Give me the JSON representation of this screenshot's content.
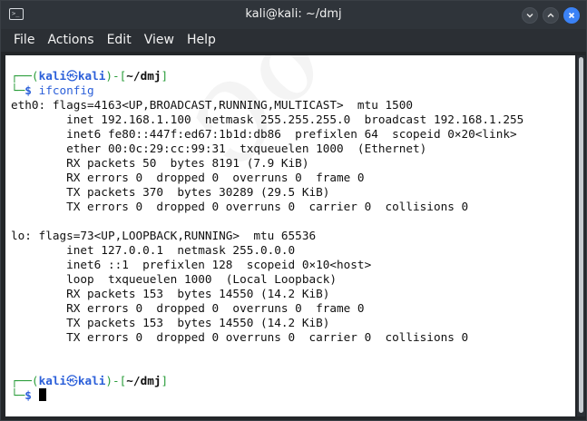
{
  "window": {
    "title": "kali@kali: ~/dmj",
    "app_icon": "terminal-icon",
    "controls": [
      "minimize-icon",
      "maximize-icon",
      "close-icon"
    ],
    "accent": "#3b82f6"
  },
  "menu": {
    "items": [
      "File",
      "Actions",
      "Edit",
      "View",
      "Help"
    ]
  },
  "terminal": {
    "background": "#ffffff",
    "prompt": {
      "open": "┌──(",
      "user": "kali",
      "skull": "㉿",
      "host": "kali",
      "mid": ")-[",
      "path": "~/dmj",
      "close": "]",
      "second": "└─",
      "dollar": "$"
    },
    "command": "ifconfig",
    "output": [
      "eth0: flags=4163<UP,BROADCAST,RUNNING,MULTICAST>  mtu 1500",
      "        inet 192.168.1.100  netmask 255.255.255.0  broadcast 192.168.1.255",
      "        inet6 fe80::447f:ed67:1b1d:db86  prefixlen 64  scopeid 0×20<link>",
      "        ether 00:0c:29:cc:99:31  txqueuelen 1000  (Ethernet)",
      "        RX packets 50  bytes 8191 (7.9 KiB)",
      "        RX errors 0  dropped 0  overruns 0  frame 0",
      "        TX packets 370  bytes 30289 (29.5 KiB)",
      "        TX errors 0  dropped 0 overruns 0  carrier 0  collisions 0",
      "",
      "lo: flags=73<UP,LOOPBACK,RUNNING>  mtu 65536",
      "        inet 127.0.0.1  netmask 255.0.0.0",
      "        inet6 ::1  prefixlen 128  scopeid 0×10<host>",
      "        loop  txqueuelen 1000  (Local Loopback)",
      "        RX packets 153  bytes 14550 (14.2 KiB)",
      "        RX errors 0  dropped 0  overruns 0  frame 0",
      "        TX packets 153  bytes 14550 (14.2 KiB)",
      "        TX errors 0  dropped 0 overruns 0  carrier 0  collisions 0",
      "",
      ""
    ]
  }
}
